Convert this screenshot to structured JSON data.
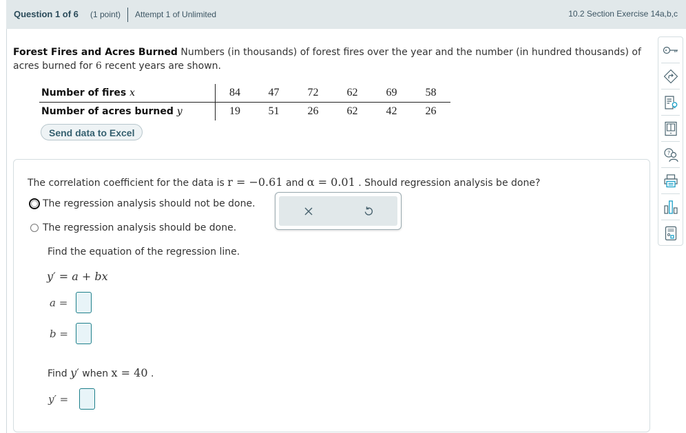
{
  "header": {
    "question": "Question 1 of 6",
    "points": "(1 point)",
    "attempt": "Attempt 1 of Unlimited",
    "section": "10.2 Section Exercise 14a,b,c"
  },
  "intro": {
    "title": "Forest Fires and Acres Burned",
    "text_before_n": " Numbers (in thousands) of forest fires over the year and the number (in hundred thousands) of acres burned for ",
    "n": "6",
    "text_after_n": " recent years are shown."
  },
  "data_table": {
    "rows": [
      {
        "label": "Number of fires ",
        "var": "x",
        "values": [
          "84",
          "47",
          "72",
          "62",
          "69",
          "58"
        ]
      },
      {
        "label": "Number of acres burned ",
        "var": "y",
        "values": [
          "19",
          "51",
          "26",
          "62",
          "42",
          "26"
        ]
      }
    ]
  },
  "excel_button": "Send data to Excel",
  "question": {
    "prefix": "The correlation coefficient for the data is ",
    "r_expr": "r = −0.61",
    "and": " and ",
    "alpha_expr": "α = 0.01",
    "suffix": " . Should regression analysis be done?",
    "options": [
      {
        "label": "The regression analysis should not be done.",
        "selected": false,
        "focused": true
      },
      {
        "label": "The regression analysis should be done.",
        "selected": false,
        "focused": false
      }
    ]
  },
  "popover": {
    "clear_icon": "close-icon",
    "undo_icon": "undo-icon"
  },
  "regression": {
    "find_eq": "Find the equation of the regression line.",
    "equation": "y′ = a + bx",
    "a_label": "a =",
    "b_label": "b =",
    "a_value": "",
    "b_value": ""
  },
  "predict": {
    "prefix": "Find ",
    "yprime": "y′",
    "middle": " when ",
    "x_expr": "x = 40",
    "suffix": " .",
    "label": "y′ =",
    "value": ""
  },
  "sidebar": {
    "items": [
      {
        "icon": "key-icon",
        "label": "Answer key"
      },
      {
        "icon": "skip-icon",
        "label": "Skip"
      },
      {
        "icon": "hint-icon",
        "label": "Hint"
      },
      {
        "icon": "ebook-icon",
        "label": "eBook"
      },
      {
        "icon": "ask-instructor-icon",
        "label": "Ask"
      },
      {
        "icon": "print-icon",
        "label": "Print"
      },
      {
        "icon": "stats-icon",
        "label": "Statistics"
      },
      {
        "icon": "calculator-icon",
        "label": "Calculator"
      }
    ]
  },
  "colors": {
    "header_bg": "#e1e8ea",
    "accent": "#1d7f8a",
    "answer_bg": "#e8f4f8",
    "icon": "#4a6470",
    "icon_accent": "#1aa0c8"
  }
}
